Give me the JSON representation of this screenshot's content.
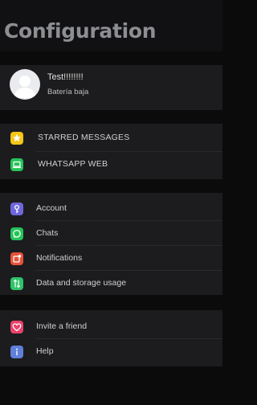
{
  "header": {
    "title": "Configuration"
  },
  "profile": {
    "name": "Test!!!!!!!!",
    "status": "Batería baja"
  },
  "quick_links": [
    {
      "label": "STARRED MESSAGES",
      "icon": "star-icon",
      "color": "#f5c518"
    },
    {
      "label": "WHATSAPP WEB",
      "icon": "laptop-icon",
      "color": "#25c45a"
    }
  ],
  "settings": [
    {
      "label": "Account",
      "icon": "key-icon",
      "color": "#6e67d9"
    },
    {
      "label": "Chats",
      "icon": "whatsapp-icon",
      "color": "#25c45a"
    },
    {
      "label": "Notifications",
      "icon": "notification-icon",
      "color": "#e8533b"
    },
    {
      "label": "Data and storage usage",
      "icon": "data-transfer-icon",
      "color": "#2fc46a"
    }
  ],
  "extras": [
    {
      "label": "Invite a friend",
      "icon": "heart-icon",
      "color": "#e8436b"
    },
    {
      "label": "Help",
      "icon": "info-icon",
      "color": "#5f7fd9"
    }
  ],
  "colors": {
    "background": "#0b0b0c",
    "panel": "#1c1c1e",
    "title": "#8d8e92"
  }
}
